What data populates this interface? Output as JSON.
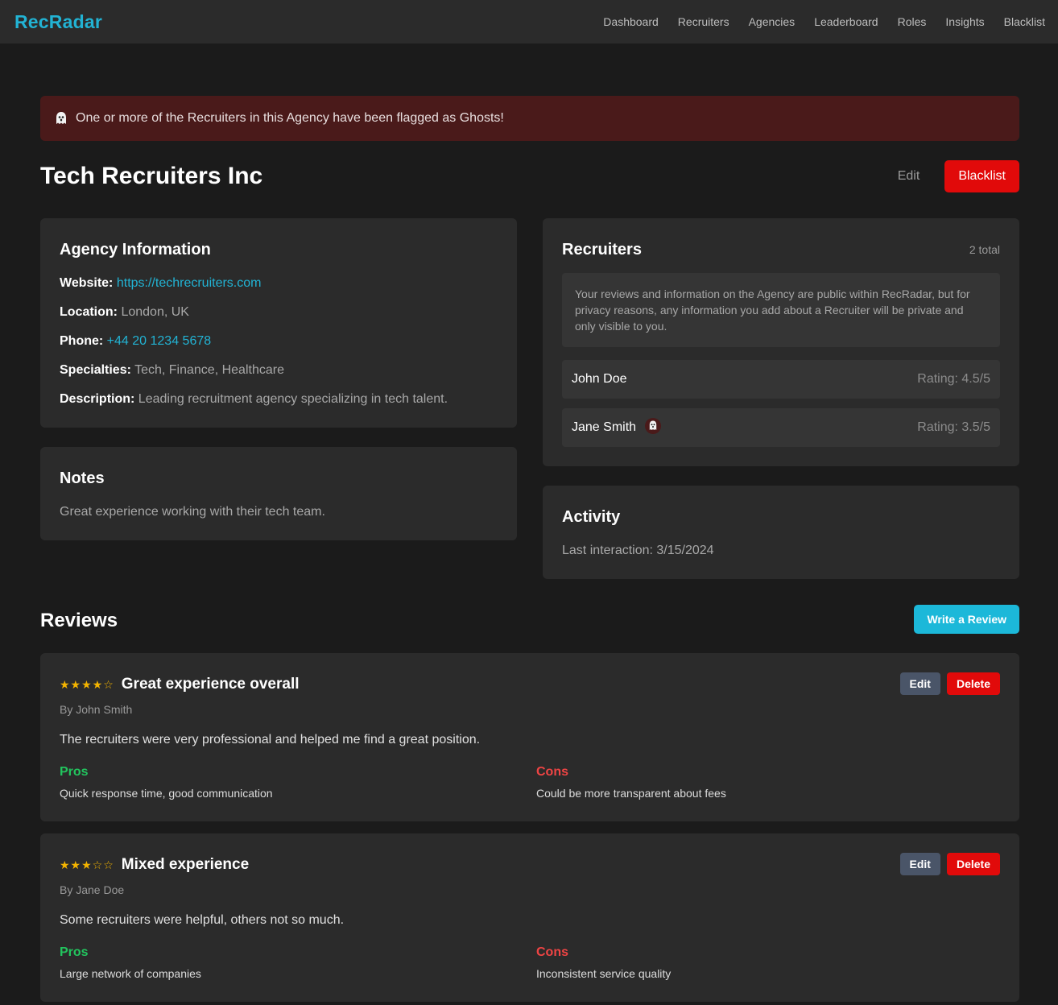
{
  "brand": "RecRadar",
  "nav": [
    "Dashboard",
    "Recruiters",
    "Agencies",
    "Leaderboard",
    "Roles",
    "Insights",
    "Blacklist"
  ],
  "alert": {
    "text": "One or more of the Recruiters in this Agency have been flagged as Ghosts!",
    "icon": "ghost-icon"
  },
  "agency": {
    "name": "Tech Recruiters Inc",
    "edit_label": "Edit",
    "blacklist_label": "Blacklist"
  },
  "info": {
    "title": "Agency Information",
    "website_label": "Website:",
    "website": "https://techrecruiters.com",
    "location_label": "Location:",
    "location": "London, UK",
    "phone_label": "Phone:",
    "phone": "+44 20 1234 5678",
    "specialties_label": "Specialties:",
    "specialties": "Tech, Finance, Healthcare",
    "description_label": "Description:",
    "description": "Leading recruitment agency specializing in tech talent."
  },
  "notes": {
    "title": "Notes",
    "text": "Great experience working with their tech team."
  },
  "recruiters": {
    "title": "Recruiters",
    "count": "2 total",
    "notice": "Your reviews and information on the Agency are public within RecRadar, but for privacy reasons, any information you add about a Recruiter will be private and only visible to you.",
    "items": [
      {
        "name": "John Doe",
        "rating": "Rating: 4.5/5",
        "ghost": false
      },
      {
        "name": "Jane Smith",
        "rating": "Rating: 3.5/5",
        "ghost": true
      }
    ]
  },
  "activity": {
    "title": "Activity",
    "last": "Last interaction: 3/15/2024"
  },
  "reviews": {
    "title": "Reviews",
    "write_label": "Write a Review",
    "edit_label": "Edit",
    "delete_label": "Delete",
    "pros_label": "Pros",
    "cons_label": "Cons",
    "items": [
      {
        "stars": "★★★★☆",
        "rating": 4,
        "title": "Great experience overall",
        "author": "By John Smith",
        "body": "The recruiters were very professional and helped me find a great position.",
        "pros": "Quick response time, good communication",
        "cons": "Could be more transparent about fees"
      },
      {
        "stars": "★★★☆☆",
        "rating": 3,
        "title": "Mixed experience",
        "author": "By Jane Doe",
        "body": "Some recruiters were helpful, others not so much.",
        "pros": "Large network of companies",
        "cons": "Inconsistent service quality"
      }
    ]
  },
  "colors": {
    "accent": "#22b3d4",
    "danger": "#e10a0a",
    "pros": "#22c55e",
    "cons": "#ef4444",
    "background": "#1b1b1b",
    "card": "#2b2b2b"
  }
}
